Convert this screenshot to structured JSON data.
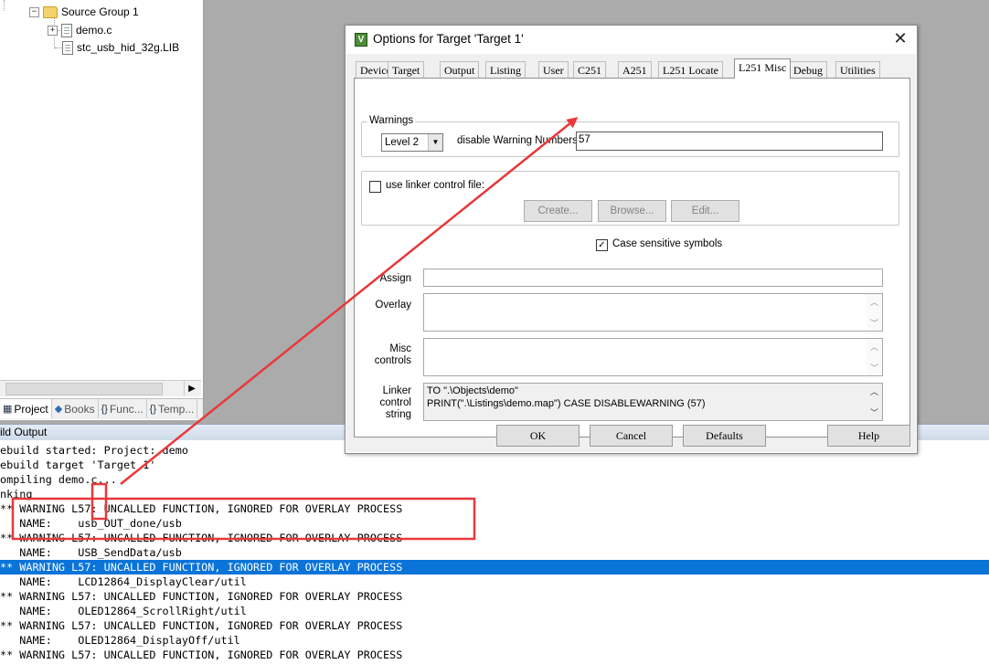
{
  "project_tree": {
    "group": "Source Group 1",
    "files": [
      "demo.c",
      "stc_usb_hid_32g.LIB"
    ]
  },
  "panel_tabs": [
    {
      "label": "Project",
      "icon": "project-icon"
    },
    {
      "label": "Books",
      "icon": "books-icon"
    },
    {
      "label": "Func...",
      "icon": "functions-icon"
    },
    {
      "label": "Temp...",
      "icon": "templates-icon"
    }
  ],
  "build_output": {
    "title": "ild Output",
    "lines": [
      "ebuild started: Project: demo",
      "ebuild target 'Target 1'",
      "ompiling demo.c...",
      "nking",
      "** WARNING L57: UNCALLED FUNCTION, IGNORED FOR OVERLAY PROCESS",
      "   NAME:    usb_OUT_done/usb",
      "** WARNING L57: UNCALLED FUNCTION, IGNORED FOR OVERLAY PROCESS",
      "   NAME:    USB_SendData/usb",
      "** WARNING L57: UNCALLED FUNCTION, IGNORED FOR OVERLAY PROCESS",
      "   NAME:    LCD12864_DisplayClear/util",
      "** WARNING L57: UNCALLED FUNCTION, IGNORED FOR OVERLAY PROCESS",
      "   NAME:    OLED12864_ScrollRight/util",
      "** WARNING L57: UNCALLED FUNCTION, IGNORED FOR OVERLAY PROCESS",
      "   NAME:    OLED12864_DisplayOff/util",
      "** WARNING L57: UNCALLED FUNCTION, IGNORED FOR OVERLAY PROCESS"
    ],
    "selected_line": 8
  },
  "dialog": {
    "title": "Options for Target 'Target 1'",
    "close": "✕",
    "tabs": [
      "Device",
      "Target",
      "Output",
      "Listing",
      "User",
      "C251",
      "A251",
      "L251 Locate",
      "L251 Misc",
      "Debug",
      "Utilities"
    ],
    "active_tab": "L251 Misc",
    "warnings": {
      "group_label": "Warnings",
      "level": "Level 2",
      "disable_label": "disable Warning Numbers:",
      "disable_value": "57"
    },
    "linker_file": {
      "checkbox_label": "use linker control file:",
      "checked": false,
      "create": "Create...",
      "browse": "Browse...",
      "edit": "Edit..."
    },
    "case_sensitive": {
      "label": "Case sensitive symbols",
      "checked": true
    },
    "assign_label": "Assign",
    "overlay_label": "Overlay",
    "misc_label_1": "Misc",
    "misc_label_2": "controls",
    "linker_label_1": "Linker",
    "linker_label_2": "control",
    "linker_label_3": "string",
    "linker_string_1": "TO \".\\Objects\\demo\"",
    "linker_string_2": "PRINT(\".\\Listings\\demo.map\") CASE DISABLEWARNING (57)",
    "buttons": {
      "ok": "OK",
      "cancel": "Cancel",
      "defaults": "Defaults",
      "help": "Help"
    }
  },
  "colors": {
    "annotation": "#e8383b",
    "selection": "#0a74d9"
  }
}
